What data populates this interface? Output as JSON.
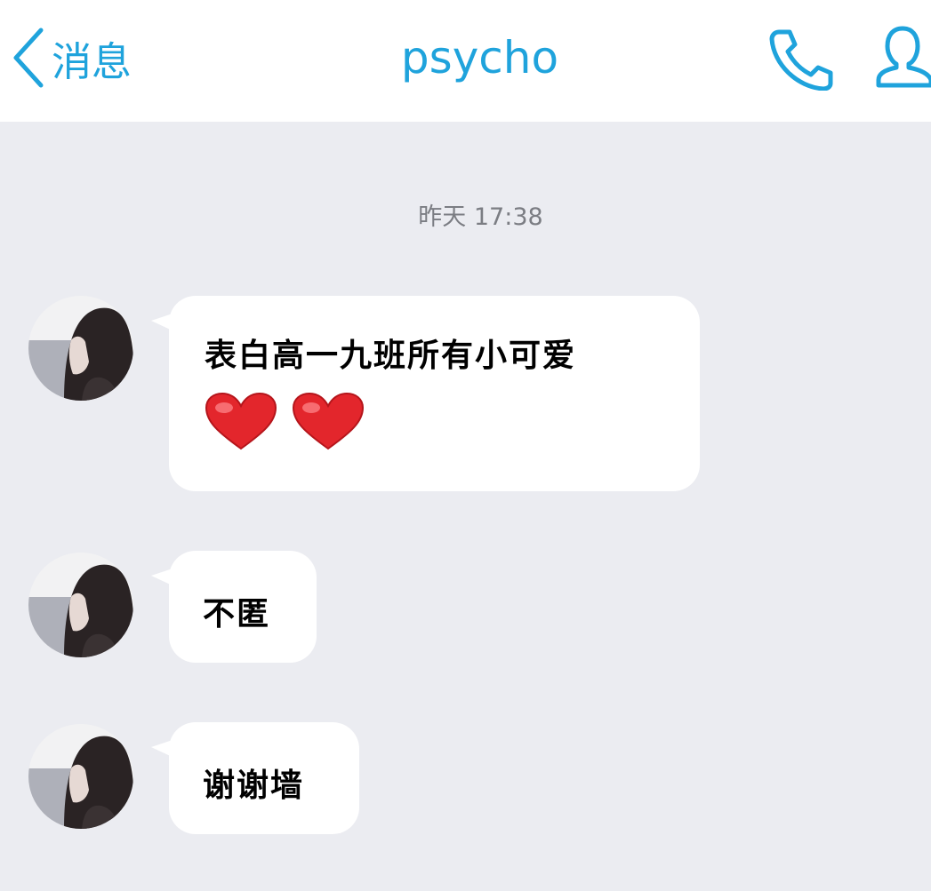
{
  "header": {
    "back_label": "消息",
    "title": "psycho",
    "icons": {
      "back": "chevron-left-icon",
      "call": "phone-icon",
      "profile": "person-icon"
    },
    "accent_color": "#1fa3dc"
  },
  "chat": {
    "timestamp": "昨天 17:38",
    "messages": [
      {
        "text": "表白高一九班所有小可爱",
        "emoji": [
          "heart-emoji",
          "heart-emoji"
        ]
      },
      {
        "text": "不匿"
      },
      {
        "text": "谢谢墙"
      }
    ]
  }
}
